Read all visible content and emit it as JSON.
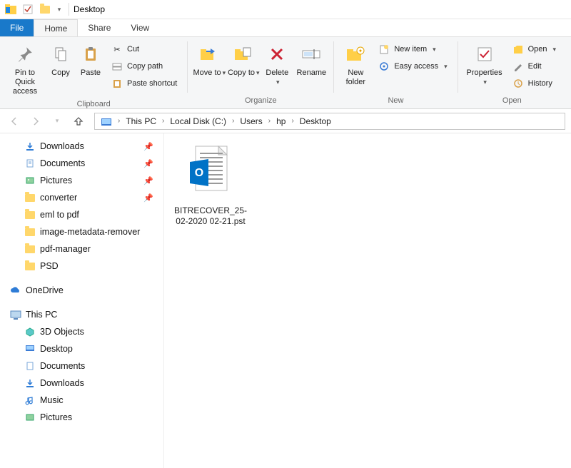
{
  "titlebar": {
    "title": "Desktop"
  },
  "tabs": {
    "file": "File",
    "home": "Home",
    "share": "Share",
    "view": "View"
  },
  "ribbon": {
    "clipboard": {
      "label": "Clipboard",
      "pin": "Pin to Quick access",
      "copy": "Copy",
      "paste": "Paste",
      "cut": "Cut",
      "copy_path": "Copy path",
      "paste_shortcut": "Paste shortcut"
    },
    "organize": {
      "label": "Organize",
      "move_to": "Move to",
      "copy_to": "Copy to",
      "delete": "Delete",
      "rename": "Rename"
    },
    "new": {
      "label": "New",
      "new_folder": "New folder",
      "new_item": "New item",
      "easy_access": "Easy access"
    },
    "open": {
      "label": "Open",
      "properties": "Properties",
      "open": "Open",
      "edit": "Edit",
      "history": "History"
    }
  },
  "breadcrumb": [
    "This PC",
    "Local Disk (C:)",
    "Users",
    "hp",
    "Desktop"
  ],
  "tree": {
    "quick": [
      {
        "label": "Downloads",
        "icon": "downloads",
        "pinned": true
      },
      {
        "label": "Documents",
        "icon": "documents",
        "pinned": true
      },
      {
        "label": "Pictures",
        "icon": "pictures",
        "pinned": true
      },
      {
        "label": "converter",
        "icon": "folder",
        "pinned": true
      },
      {
        "label": "eml to pdf",
        "icon": "folder",
        "pinned": false
      },
      {
        "label": "image-metadata-remover",
        "icon": "folder",
        "pinned": false
      },
      {
        "label": "pdf-manager",
        "icon": "folder",
        "pinned": false
      },
      {
        "label": "PSD",
        "icon": "folder",
        "pinned": false
      }
    ],
    "onedrive": "OneDrive",
    "thispc": {
      "label": "This PC",
      "children": [
        {
          "label": "3D Objects",
          "icon": "3d"
        },
        {
          "label": "Desktop",
          "icon": "desktop"
        },
        {
          "label": "Documents",
          "icon": "documents"
        },
        {
          "label": "Downloads",
          "icon": "downloads"
        },
        {
          "label": "Music",
          "icon": "music"
        },
        {
          "label": "Pictures",
          "icon": "pictures"
        }
      ]
    }
  },
  "file": {
    "name": "BITRECOVER_25-02-2020 02-21.pst"
  }
}
